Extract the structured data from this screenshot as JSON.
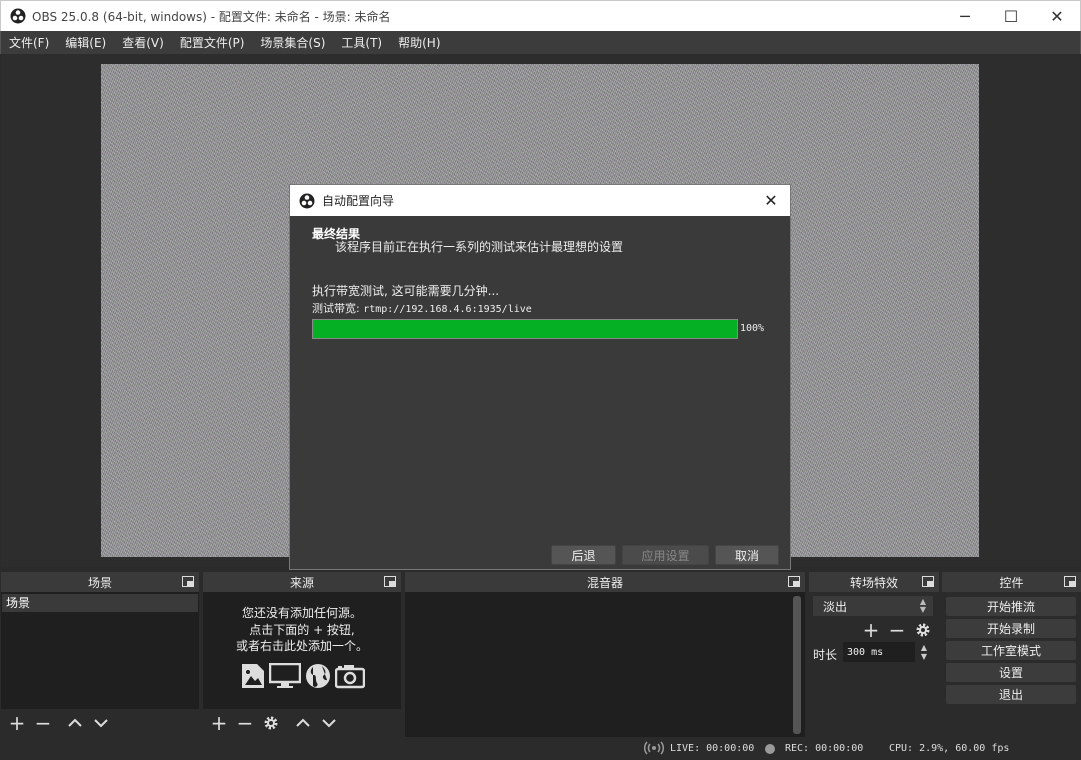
{
  "window": {
    "title": "OBS 25.0.8 (64-bit, windows) - 配置文件: 未命名 - 场景: 未命名",
    "minimize_icon": "─",
    "maximize_icon": "☐",
    "close_icon": "✕"
  },
  "menu": [
    "文件(F)",
    "编辑(E)",
    "查看(V)",
    "配置文件(P)",
    "场景集合(S)",
    "工具(T)",
    "帮助(H)"
  ],
  "dialog": {
    "title": "自动配置向导",
    "heading": "最终结果",
    "subheading": "该程序目前正在执行一系列的测试来估计最理想的设置",
    "status": "执行带宽测试, 这可能需要几分钟...",
    "server_label": "测试带宽: ",
    "server_url": "rtmp://192.168.4.6:1935/live",
    "progress": 100,
    "progress_text": "100%",
    "buttons": {
      "back": "后退",
      "apply": "应用设置",
      "cancel": "取消"
    },
    "close_icon": "✕"
  },
  "docks": {
    "scenes": {
      "title": "场景",
      "items": [
        "场景"
      ]
    },
    "sources": {
      "title": "来源",
      "hint": [
        "您还没有添加任何源。",
        "点击下面的 + 按钮,",
        "或者右击此处添加一个。"
      ]
    },
    "mixer": {
      "title": "混音器"
    },
    "transitions": {
      "title": "转场特效",
      "selected": "淡出",
      "duration_label": "时长",
      "duration_value": "300 ms"
    },
    "controls": {
      "title": "控件",
      "buttons": [
        "开始推流",
        "开始录制",
        "工作室模式",
        "设置",
        "退出"
      ]
    }
  },
  "status_bar": {
    "live": "LIVE: 00:00:00",
    "rec": "REC: 00:00:00",
    "cpu": "CPU: 2.9%, 60.00 fps"
  },
  "colors": {
    "progress": "#06b025",
    "background": "#2b2b2b"
  }
}
